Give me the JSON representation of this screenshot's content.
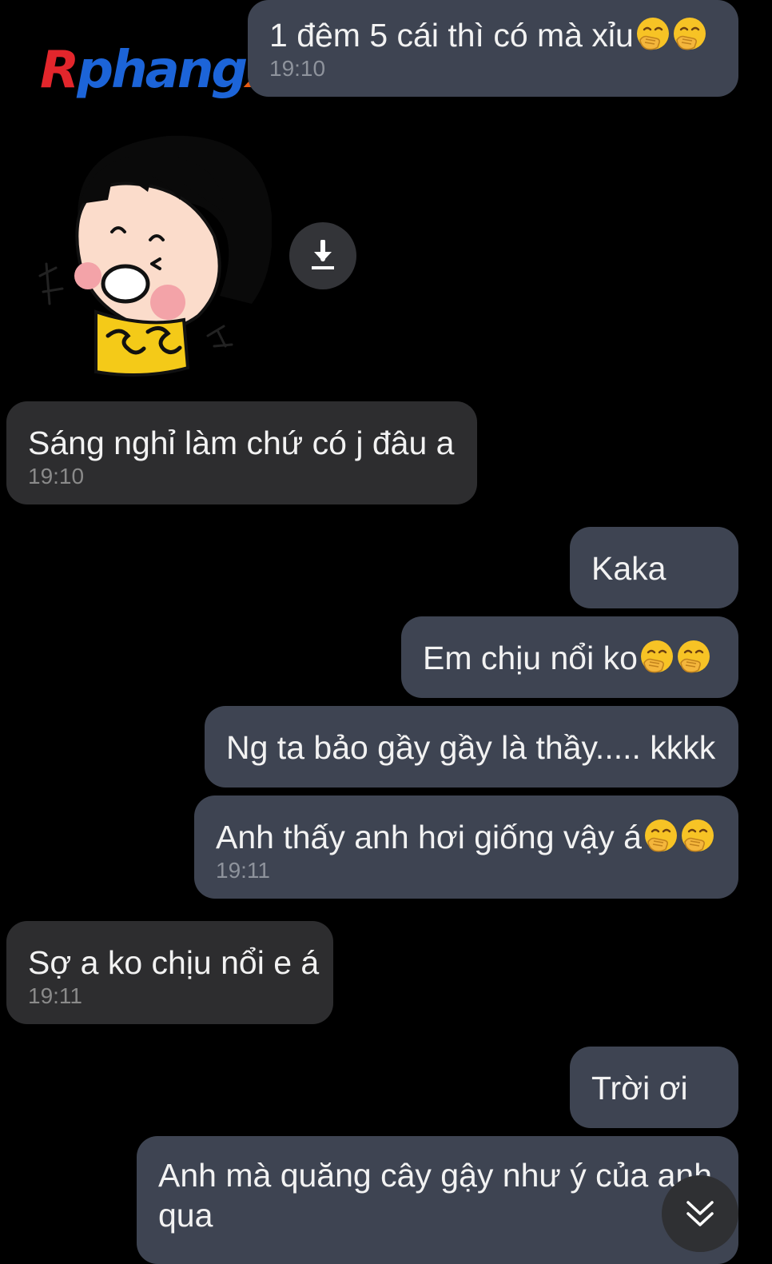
{
  "watermark": {
    "part1": "R",
    "part2": "phang",
    "part3": "x"
  },
  "messages": {
    "m1": {
      "text": "1 đêm 5 cái thì có mà xỉu",
      "emoji": "face-with-hand-over-mouth",
      "time": "19:10"
    },
    "m2": {
      "text": "Sáng nghỉ làm chứ có j đâu a",
      "time": "19:10"
    },
    "m3": {
      "text": "Kaka"
    },
    "m4": {
      "text": "Em chịu nổi ko",
      "emoji": "face-with-hand-over-mouth"
    },
    "m5": {
      "text": "Ng ta bảo gầy gầy là thầy..... kkkk"
    },
    "m6": {
      "text": "Anh thấy anh hơi giống vậy á",
      "emoji": "face-with-hand-over-mouth",
      "time": "19:11"
    },
    "m7": {
      "text": "Sợ a ko chịu nổi e á",
      "time": "19:11"
    },
    "m8": {
      "text": "Trời ơi"
    },
    "m9": {
      "text": "Anh mà quăng cây gậy như ý của anh qua"
    }
  },
  "sticker": {
    "icon": "laughing-girl-sticker",
    "download_icon": "download-icon"
  },
  "scroll_icon": "double-chevron-down-icon",
  "colors": {
    "background": "#000000",
    "outgoing_bubble": "#3e4452",
    "incoming_bubble": "#2d2d2f",
    "timestamp": "#8e939c"
  }
}
